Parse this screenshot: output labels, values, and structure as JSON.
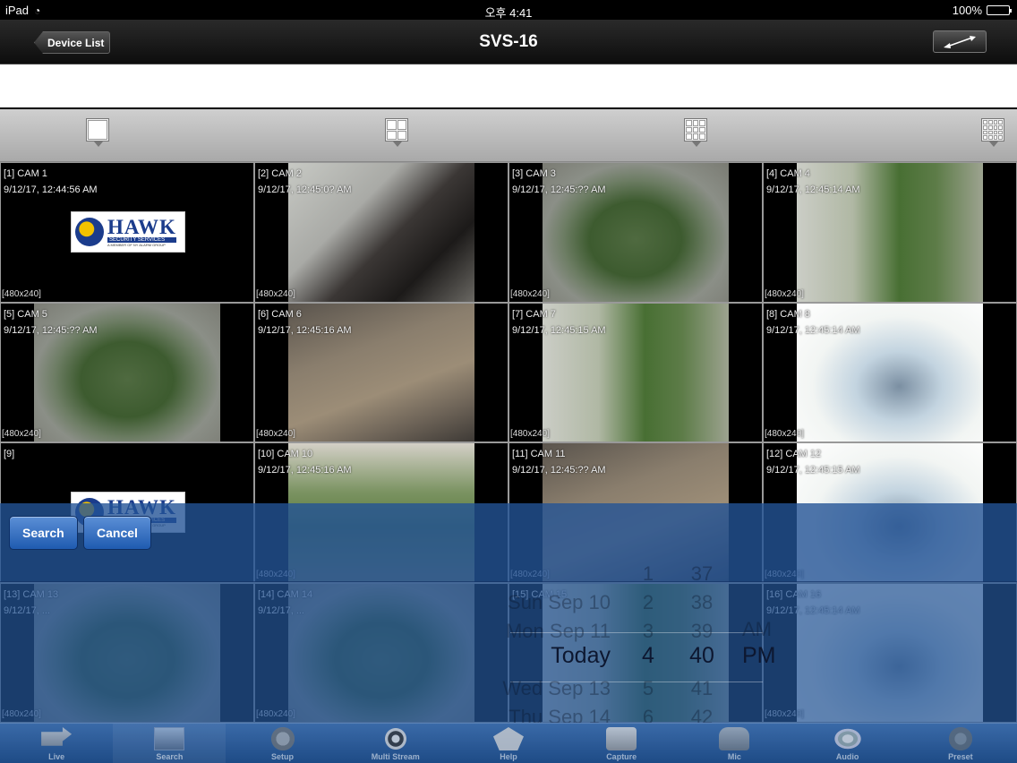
{
  "status_bar": {
    "device": "iPad",
    "time": "오후 4:41",
    "battery": "100%"
  },
  "nav": {
    "back_label": "Device List",
    "title": "SVS-16"
  },
  "layout_buttons": [
    {
      "name": "layout-1x1",
      "cells": 1
    },
    {
      "name": "layout-2x2",
      "cells": 4
    },
    {
      "name": "layout-3x3",
      "cells": 9
    },
    {
      "name": "layout-4x4",
      "cells": 16
    }
  ],
  "cameras": [
    {
      "label": "[1] CAM 1",
      "timestamp": "9/12/17, 12:44:56 AM",
      "resolution": "[480x240]",
      "feed": "logo"
    },
    {
      "label": "[2] CAM 2",
      "timestamp": "9/12/17, 12:45:0? AM",
      "resolution": "[480x240]",
      "feed": "indoor"
    },
    {
      "label": "[3] CAM 3",
      "timestamp": "9/12/17, 12:45:?? AM",
      "resolution": "[480x240]",
      "feed": "planter"
    },
    {
      "label": "[4] CAM 4",
      "timestamp": "9/12/17, 12:45:14 AM",
      "resolution": "[480x240]",
      "feed": "street"
    },
    {
      "label": "[5] CAM 5",
      "timestamp": "9/12/17, 12:45:?? AM",
      "resolution": "[480x240]",
      "feed": "planter"
    },
    {
      "label": "[6] CAM 6",
      "timestamp": "9/12/17, 12:45:16 AM",
      "resolution": "[480x240]",
      "feed": "wood"
    },
    {
      "label": "[7] CAM 7",
      "timestamp": "9/12/17, 12:45:15 AM",
      "resolution": "[480x240]",
      "feed": "street"
    },
    {
      "label": "[8] CAM 8",
      "timestamp": "9/12/17, 12:45:14 AM",
      "resolution": "[480x240]",
      "feed": "bright"
    },
    {
      "label": "[9]",
      "timestamp": "",
      "resolution": "",
      "feed": "logo"
    },
    {
      "label": "[10] CAM 10",
      "timestamp": "9/12/17, 12:45:16 AM",
      "resolution": "[480x240]",
      "feed": "trees"
    },
    {
      "label": "[11] CAM 11",
      "timestamp": "9/12/17, 12:45:?? AM",
      "resolution": "[480x240]",
      "feed": "wood"
    },
    {
      "label": "[12] CAM 12",
      "timestamp": "9/12/17, 12:45:15 AM",
      "resolution": "[480x240]",
      "feed": "bright"
    },
    {
      "label": "[13] CAM 13",
      "timestamp": "9/12/17, ...",
      "resolution": "[480x240]",
      "feed": "planter"
    },
    {
      "label": "[14] CAM 14",
      "timestamp": "9/12/17, ...",
      "resolution": "[480x240]",
      "feed": "planter"
    },
    {
      "label": "[15] CAM 15",
      "timestamp": "",
      "resolution": "",
      "feed": "street"
    },
    {
      "label": "[16] CAM 16",
      "timestamp": "9/12/17, 12:45:14 AM",
      "resolution": "[480x240]",
      "feed": "bright"
    }
  ],
  "logo": {
    "name": "HAWK",
    "tagline": "SECURITY SERVICES",
    "subline": "A MEMBER OF NY ALARM GROUP"
  },
  "overlay": {
    "search_label": "Search",
    "cancel_label": "Cancel"
  },
  "picker": {
    "dates": [
      "Sun Sep 10",
      "Mon Sep 11",
      "Today",
      "Wed Sep 13",
      "Thu Sep 14"
    ],
    "hours": [
      "1",
      "2",
      "3",
      "4",
      "5",
      "6"
    ],
    "minutes": [
      "37",
      "38",
      "39",
      "40",
      "41",
      "42"
    ],
    "ampm": [
      "AM",
      "PM"
    ],
    "selected": {
      "date": "Today",
      "hour": "4",
      "minute": "40",
      "ampm": "PM"
    }
  },
  "tabs": [
    {
      "label": "Live",
      "icon": "camera-icon"
    },
    {
      "label": "Search",
      "icon": "search-icon"
    },
    {
      "label": "Setup",
      "icon": "gear-icon"
    },
    {
      "label": "Multi Stream",
      "icon": "film-reel-icon"
    },
    {
      "label": "Help",
      "icon": "help-icon"
    },
    {
      "label": "Capture",
      "icon": "capture-icon"
    },
    {
      "label": "Mic",
      "icon": "microphone-icon"
    },
    {
      "label": "Audio",
      "icon": "speaker-icon"
    },
    {
      "label": "Preset",
      "icon": "preset-icon"
    }
  ],
  "active_tab": "Search"
}
